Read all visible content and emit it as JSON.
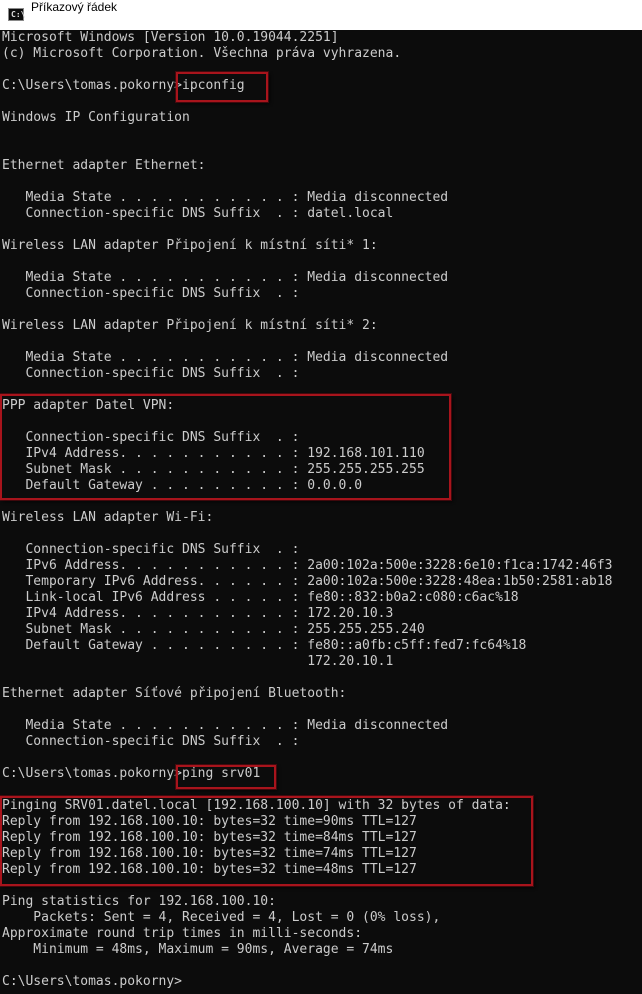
{
  "window": {
    "title": "Příkazový řádek",
    "icon": "cmd-icon",
    "icon_text": "C:\\"
  },
  "console": {
    "lines": [
      "Microsoft Windows [Version 10.0.19044.2251]",
      "(c) Microsoft Corporation. Všechna práva vyhrazena.",
      "",
      "C:\\Users\\tomas.pokorny>ipconfig",
      "",
      "Windows IP Configuration",
      "",
      "",
      "Ethernet adapter Ethernet:",
      "",
      "   Media State . . . . . . . . . . . : Media disconnected",
      "   Connection-specific DNS Suffix  . : datel.local",
      "",
      "Wireless LAN adapter Připojení k místní síti* 1:",
      "",
      "   Media State . . . . . . . . . . . : Media disconnected",
      "   Connection-specific DNS Suffix  . :",
      "",
      "Wireless LAN adapter Připojení k místní síti* 2:",
      "",
      "   Media State . . . . . . . . . . . : Media disconnected",
      "   Connection-specific DNS Suffix  . :",
      "",
      "PPP adapter Datel VPN:",
      "",
      "   Connection-specific DNS Suffix  . :",
      "   IPv4 Address. . . . . . . . . . . : 192.168.101.110",
      "   Subnet Mask . . . . . . . . . . . : 255.255.255.255",
      "   Default Gateway . . . . . . . . . : 0.0.0.0",
      "",
      "Wireless LAN adapter Wi-Fi:",
      "",
      "   Connection-specific DNS Suffix  . :",
      "   IPv6 Address. . . . . . . . . . . : 2a00:102a:500e:3228:6e10:f1ca:1742:46f3",
      "   Temporary IPv6 Address. . . . . . : 2a00:102a:500e:3228:48ea:1b50:2581:ab18",
      "   Link-local IPv6 Address . . . . . : fe80::832:b0a2:c080:c6ac%18",
      "   IPv4 Address. . . . . . . . . . . : 172.20.10.3",
      "   Subnet Mask . . . . . . . . . . . : 255.255.255.240",
      "   Default Gateway . . . . . . . . . : fe80::a0fb:c5ff:fed7:fc64%18",
      "                                       172.20.10.1",
      "",
      "Ethernet adapter Síťové připojení Bluetooth:",
      "",
      "   Media State . . . . . . . . . . . : Media disconnected",
      "   Connection-specific DNS Suffix  . :",
      "",
      "C:\\Users\\tomas.pokorny>ping srv01",
      "",
      "Pinging SRV01.datel.local [192.168.100.10] with 32 bytes of data:",
      "Reply from 192.168.100.10: bytes=32 time=90ms TTL=127",
      "Reply from 192.168.100.10: bytes=32 time=84ms TTL=127",
      "Reply from 192.168.100.10: bytes=32 time=74ms TTL=127",
      "Reply from 192.168.100.10: bytes=32 time=48ms TTL=127",
      "",
      "Ping statistics for 192.168.100.10:",
      "    Packets: Sent = 4, Received = 4, Lost = 0 (0% loss),",
      "Approximate round trip times in milli-seconds:",
      "    Minimum = 48ms, Maximum = 90ms, Average = 74ms",
      "",
      "C:\\Users\\tomas.pokorny>"
    ]
  },
  "colors": {
    "background": "#0c0c0c",
    "text": "#cccccc",
    "highlight": "#a8141c"
  }
}
